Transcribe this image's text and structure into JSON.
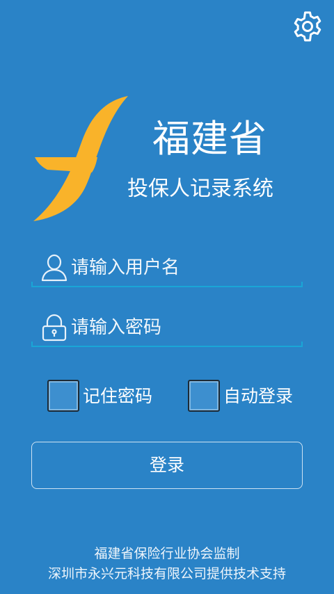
{
  "settings": {
    "icon": "gear-icon"
  },
  "logo": {
    "icon": "brand-f-logo",
    "color": "#f9b32a"
  },
  "header": {
    "title": "福建省",
    "subtitle": "投保人记录系统"
  },
  "form": {
    "username": {
      "placeholder": "请输入用户名",
      "icon": "user-icon"
    },
    "password": {
      "placeholder": "请输入密码",
      "icon": "lock-icon"
    },
    "remember_password": {
      "label": "记住密码",
      "checked": false
    },
    "auto_login": {
      "label": "自动登录",
      "checked": false
    },
    "login_button": "登录"
  },
  "footer": {
    "line1": "福建省保险行业协会监制",
    "line2": "深圳市永兴元科技有限公司提供技术支持"
  },
  "colors": {
    "background": "#2a83c7",
    "accent_line": "#1aa6d6",
    "brand_yellow": "#f9b32a"
  }
}
